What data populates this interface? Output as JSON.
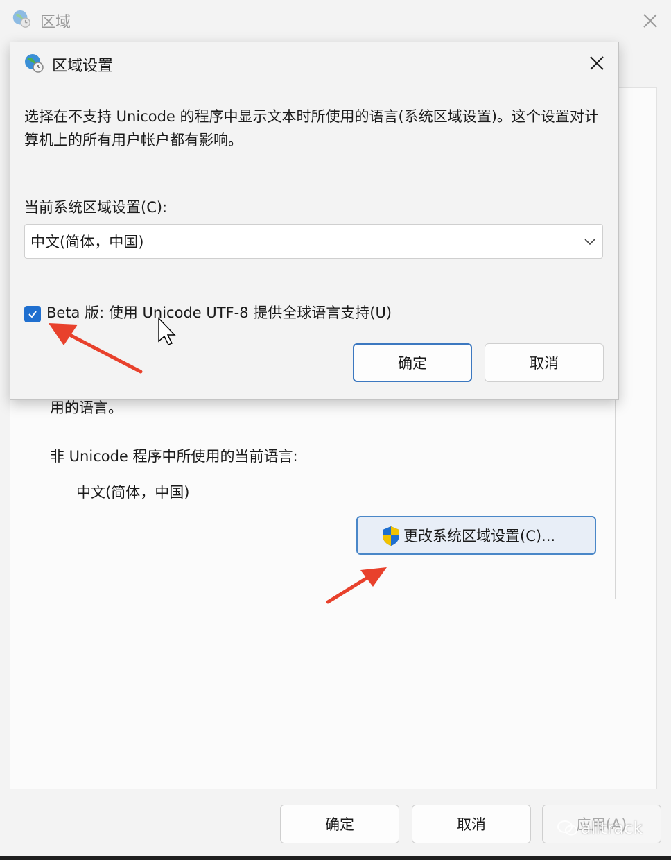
{
  "outer_window": {
    "title": "区域",
    "desc_tail": "用的语言。",
    "current_language_label": "非 Unicode 程序中所使用的当前语言:",
    "current_language_value": "中文(简体，中国)",
    "change_locale_button": "更改系统区域设置(C)...",
    "buttons": {
      "ok": "确定",
      "cancel": "取消",
      "apply": "应用(A)"
    }
  },
  "dialog": {
    "title": "区域设置",
    "description": "选择在不支持 Unicode 的程序中显示文本时所使用的语言(系统区域设置)。这个设置对计算机上的所有用户帐户都有影响。",
    "current_locale_label": "当前系统区域设置(C):",
    "selected_locale": "中文(简体，中国)",
    "utf8_checkbox_label": "Beta 版: 使用 Unicode UTF-8 提供全球语言支持(U)",
    "utf8_checked": true,
    "buttons": {
      "ok": "确定",
      "cancel": "取消"
    }
  },
  "watermark": "alltrack",
  "colors": {
    "accent": "#1f6fcf",
    "annotation_arrow": "#e8412c"
  }
}
